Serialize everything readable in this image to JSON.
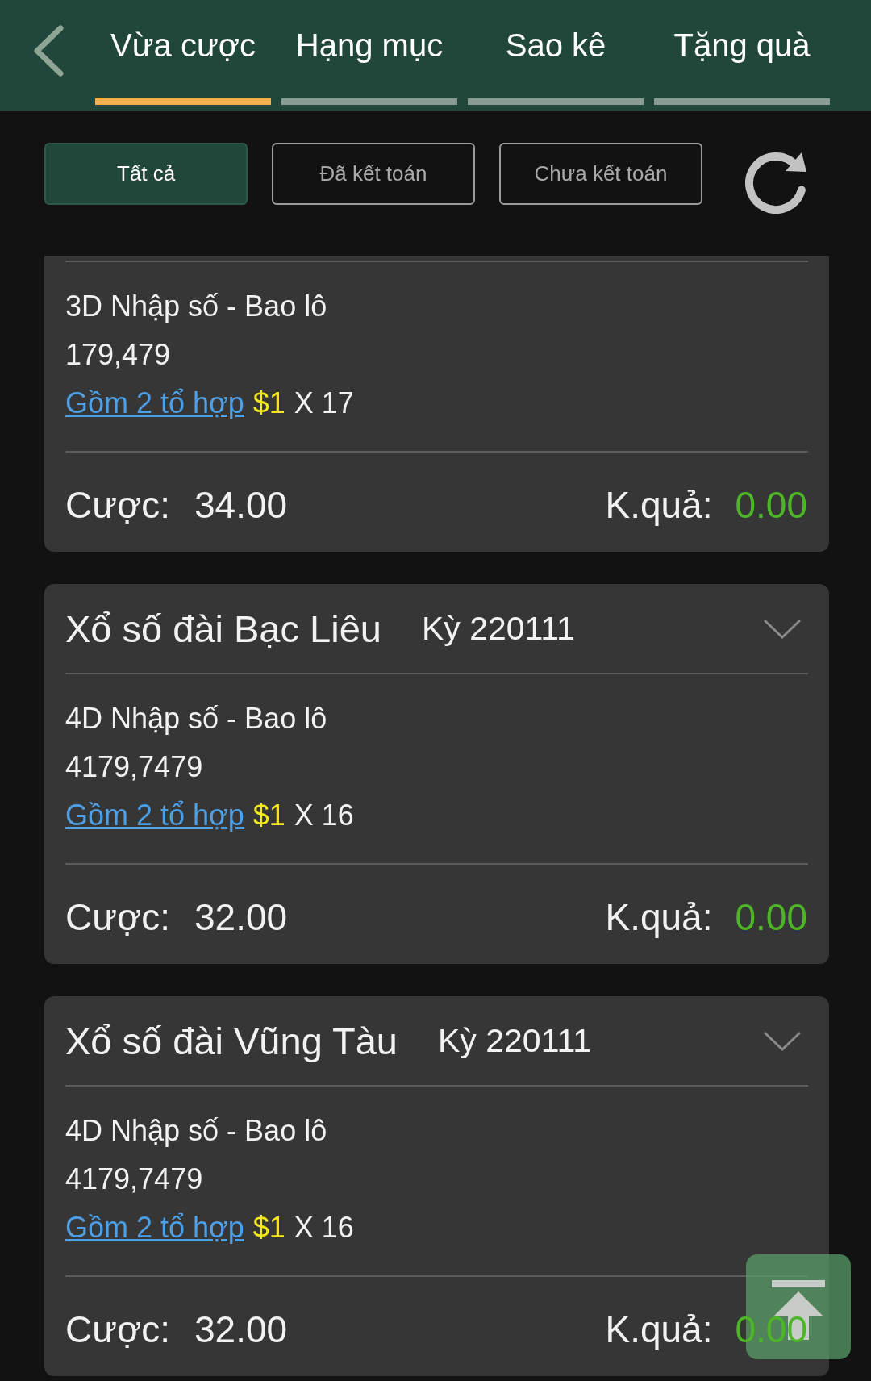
{
  "top_bar": {
    "tabs": [
      {
        "label": "Vừa cược",
        "selected": true
      },
      {
        "label": "Hạng mục",
        "selected": false
      },
      {
        "label": "Sao kê",
        "selected": false
      },
      {
        "label": "Tặng quà",
        "selected": false
      }
    ]
  },
  "filters": [
    {
      "label": "Tất cả",
      "selected": true
    },
    {
      "label": "Đã kết toán",
      "selected": false
    },
    {
      "label": "Chưa kết toán",
      "selected": false
    }
  ],
  "bets": [
    {
      "bet_type": "3D Nhập số - Bao lô",
      "numbers": "179,479",
      "combination_link": "Gồm 2 tổ hợp",
      "unit_amount": "$1",
      "multiplier": "X 17",
      "stake_label": "Cược:",
      "stake": "34.00",
      "result_label": "K.quả:",
      "result": "0.00"
    },
    {
      "lottery": "Xổ số đài Bạc Liêu",
      "period": "Kỳ 220111",
      "bet_type": "4D Nhập số - Bao lô",
      "numbers": "4179,7479",
      "combination_link": "Gồm 2 tổ hợp",
      "unit_amount": "$1",
      "multiplier": "X 16",
      "stake_label": "Cược:",
      "stake": "32.00",
      "result_label": "K.quả:",
      "result": "0.00"
    },
    {
      "lottery": "Xổ số đài Vũng Tàu",
      "period": "Kỳ 220111",
      "bet_type": "4D Nhập số - Bao lô",
      "numbers": "4179,7479",
      "combination_link": "Gồm 2 tổ hợp",
      "unit_amount": "$1",
      "multiplier": "X 16",
      "stake_label": "Cược:",
      "stake": "32.00",
      "result_label": "K.quả:",
      "result": "0.00"
    }
  ]
}
